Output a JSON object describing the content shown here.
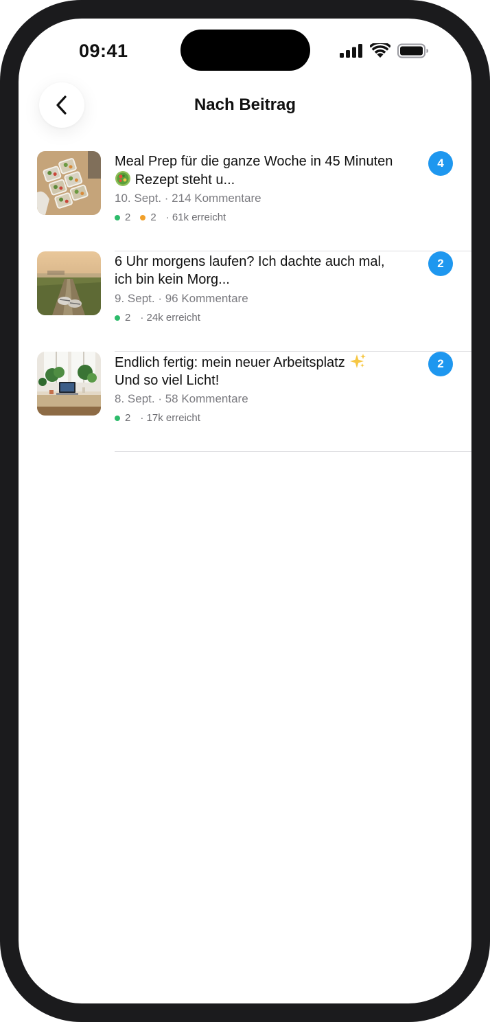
{
  "status_bar": {
    "time": "09:41"
  },
  "header": {
    "title": "Nach Beitrag",
    "back_icon": "chevron-left-icon"
  },
  "colors": {
    "accent": "#1e97ef",
    "green": "#2dbb6b",
    "orange": "#f1a02a",
    "muted": "#7b7b80"
  },
  "posts": [
    {
      "title_before": "Meal Prep für die ganze Woche in 45 Minuten",
      "title_icon": "salad-emoji-icon",
      "title_after": "Rezept steht u...",
      "meta": "10. Sept. · 214 Kommentare",
      "green_count": "2",
      "orange_count": "2",
      "reach": "· 61k erreicht",
      "badge": "4"
    },
    {
      "title": "6 Uhr morgens laufen? Ich dachte auch mal, ich bin kein Morg...",
      "meta": "9. Sept. · 96 Kommentare",
      "green_count": "2",
      "reach": "· 24k erreicht",
      "badge": "2"
    },
    {
      "title_before": "Endlich fertig: mein neuer Arbeitsplatz",
      "title_icon": "sparkles-emoji-icon",
      "title_after": "Und so viel Licht!",
      "meta": "8. Sept. · 58 Kommentare",
      "green_count": "2",
      "reach": "· 17k erreicht",
      "badge": "2"
    }
  ]
}
